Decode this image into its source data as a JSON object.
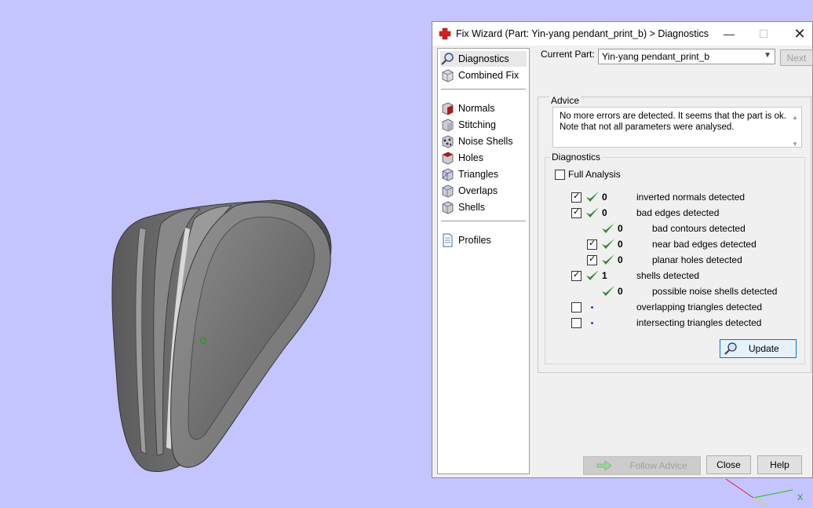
{
  "window": {
    "title": "Fix Wizard (Part: Yin-yang pendant_print_b) > Diagnostics",
    "minimize_icon": "minimize-icon",
    "maximize_icon": "maximize-icon",
    "close_icon": "close-icon"
  },
  "nav": {
    "items": [
      {
        "label": "Diagnostics",
        "icon": "magnifier-icon"
      },
      {
        "label": "Combined Fix",
        "icon": "cube-icon"
      },
      {
        "label": "Normals",
        "icon": "normals-cube-icon"
      },
      {
        "label": "Stitching",
        "icon": "stitching-cube-icon"
      },
      {
        "label": "Noise Shells",
        "icon": "noise-shells-icon"
      },
      {
        "label": "Holes",
        "icon": "holes-cube-icon"
      },
      {
        "label": "Triangles",
        "icon": "triangles-cube-icon"
      },
      {
        "label": "Overlaps",
        "icon": "overlaps-cube-icon"
      },
      {
        "label": "Shells",
        "icon": "shells-cube-icon"
      },
      {
        "label": "Profiles",
        "icon": "document-icon"
      }
    ]
  },
  "header": {
    "current_part_label": "Current Part:",
    "current_part_value": "Yin-yang pendant_print_b",
    "next_label": "Next"
  },
  "advice": {
    "title": "Advice",
    "line1": "No more errors are detected. It seems that the part is ok.",
    "line2": "Note that not all parameters were analysed."
  },
  "diagnostics": {
    "title": "Diagnostics",
    "full_analysis_label": "Full Analysis",
    "full_analysis_checked": false,
    "rows": [
      {
        "checkbox": true,
        "checked": true,
        "status": "ok",
        "count": "0",
        "label": "inverted normals detected"
      },
      {
        "checkbox": true,
        "checked": true,
        "status": "ok",
        "count": "0",
        "label": "bad edges detected"
      },
      {
        "checkbox": false,
        "checked": false,
        "status": "ok",
        "count": "0",
        "label": "bad contours detected"
      },
      {
        "checkbox": true,
        "checked": true,
        "status": "ok",
        "count": "0",
        "label": "near bad edges detected"
      },
      {
        "checkbox": true,
        "checked": true,
        "status": "ok",
        "count": "0",
        "label": "planar holes detected"
      },
      {
        "checkbox": true,
        "checked": true,
        "status": "ok",
        "count": "1",
        "label": "shells detected"
      },
      {
        "checkbox": false,
        "checked": false,
        "status": "ok",
        "count": "0",
        "label": "possible noise shells detected"
      },
      {
        "checkbox": true,
        "checked": false,
        "status": "none",
        "count": "",
        "label": "overlapping triangles detected"
      },
      {
        "checkbox": true,
        "checked": false,
        "status": "none",
        "count": "",
        "label": "intersecting triangles detected"
      }
    ],
    "update_label": "Update"
  },
  "footer": {
    "follow_advice_label": "Follow Advice",
    "close_label": "Close",
    "help_label": "Help"
  },
  "colors": {
    "viewport_bg": "#c4c4fe",
    "check_green": "#2e8b3c",
    "accent_blue": "#0078d7"
  }
}
